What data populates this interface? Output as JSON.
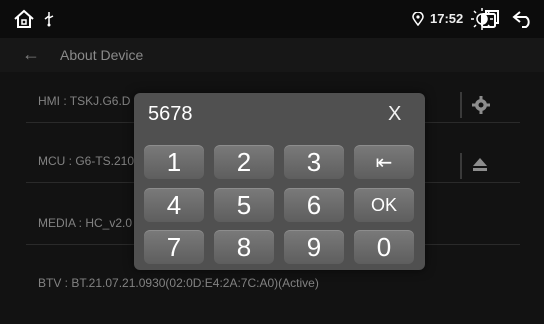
{
  "status_bar": {
    "time": "17:52",
    "icons": [
      "home-icon",
      "usb-icon",
      "location-icon",
      "brightness-icon",
      "recent-apps-icon",
      "back-icon"
    ]
  },
  "title_bar": {
    "back_glyph": "←",
    "title": "About Device"
  },
  "rows": [
    {
      "label": "HMI : TSKJ.G6.D"
    },
    {
      "label": "MCU : G6-TS.210"
    },
    {
      "label": "MEDIA : HC_v2.0"
    },
    {
      "label": "BTV : BT.21.07.21.0930(02:0D:E4:2A:7C:A0)(Active)"
    }
  ],
  "row_icons": [
    "gear-icon",
    "eject-icon"
  ],
  "keypad": {
    "display_value": "5678",
    "close_label": "X",
    "keys": [
      "1",
      "2",
      "3",
      "⇤",
      "4",
      "5",
      "6",
      "OK",
      "7",
      "8",
      "9",
      "0"
    ]
  }
}
